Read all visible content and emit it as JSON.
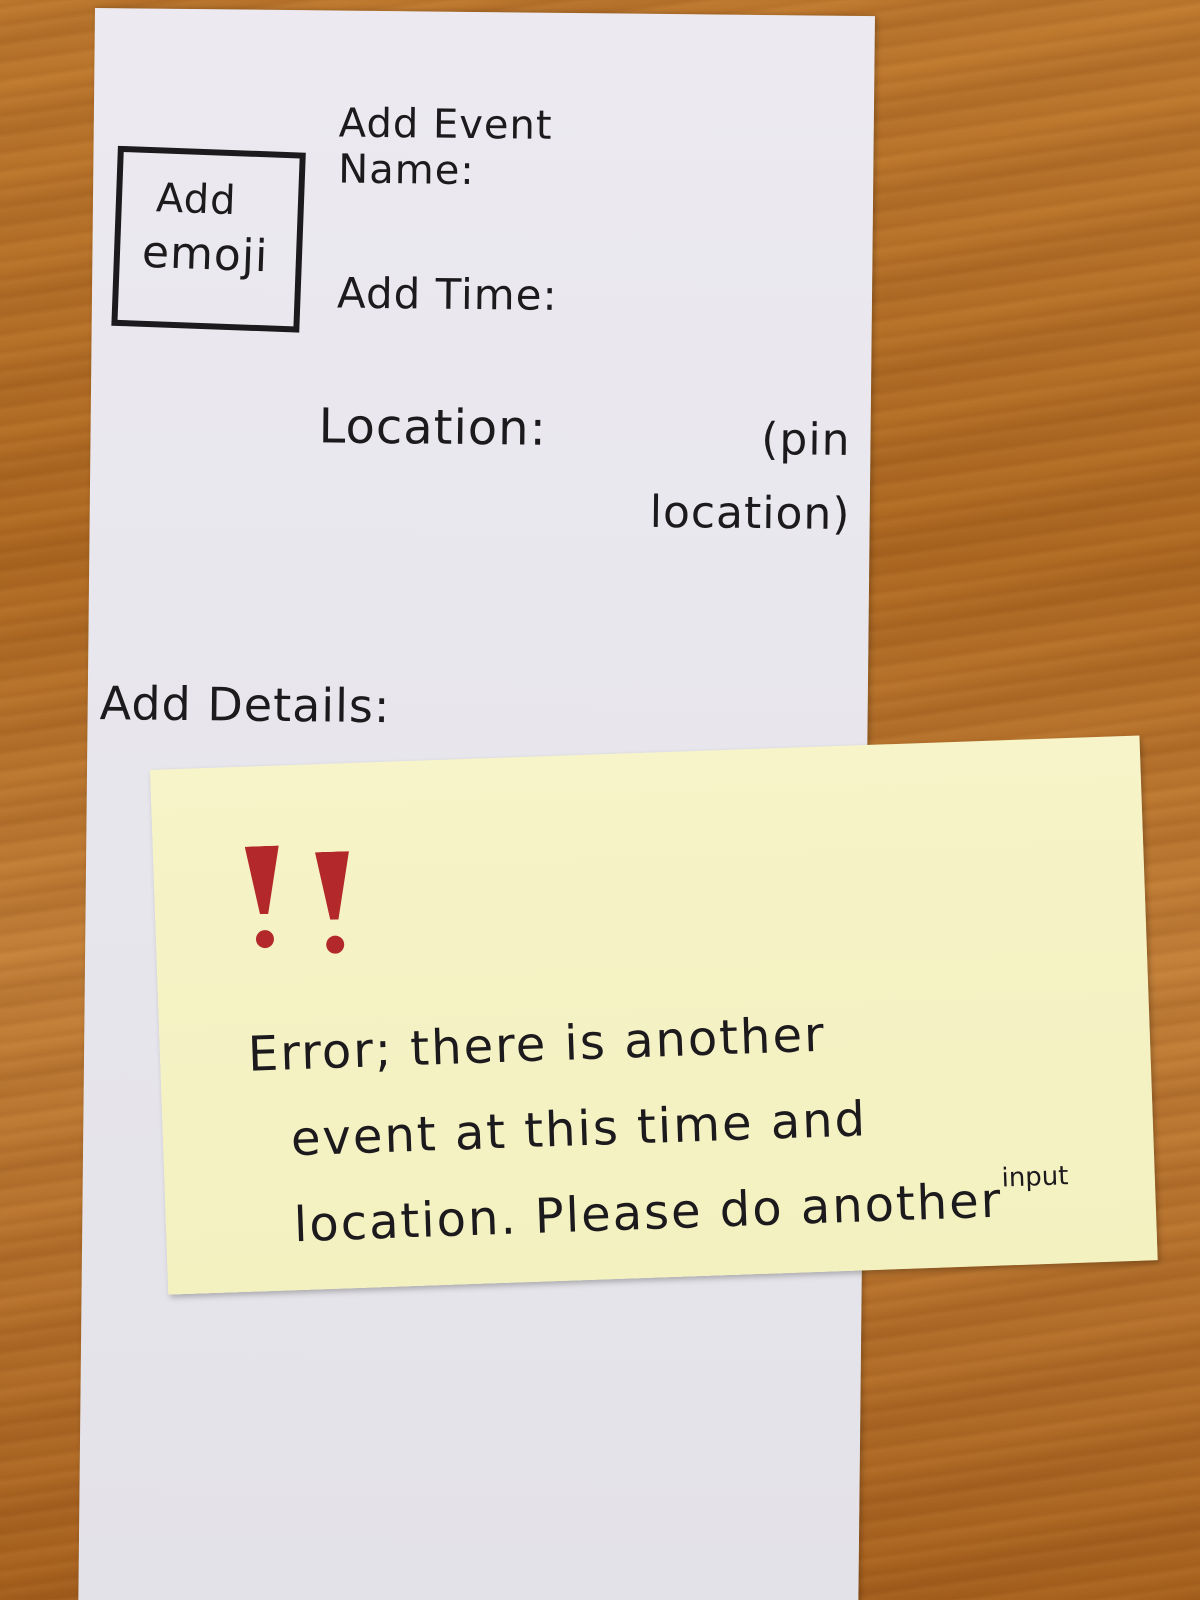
{
  "form": {
    "emoji_button_line1": "Add",
    "emoji_button_line2": "emoji",
    "event_name_label": "Add Event Name:",
    "time_label": "Add Time:",
    "location_label": "Location:",
    "location_hint": "(pin location)",
    "details_label": "Add Details:"
  },
  "error_note": {
    "icon": "double-exclamation-icon",
    "accent_color": "#b3282a",
    "line1": "Error; there is another",
    "line2": "event at this time and",
    "line3_main": "location. Please do another",
    "line3_sup": "input"
  }
}
